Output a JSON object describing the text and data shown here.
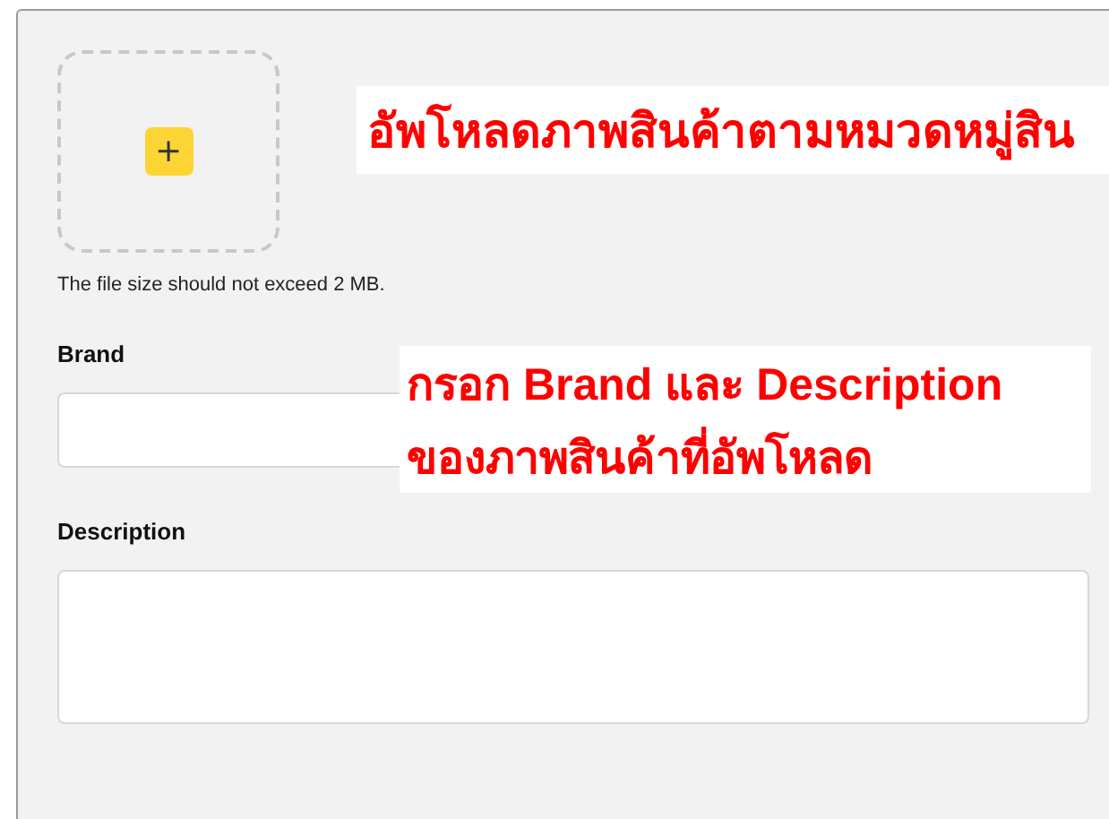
{
  "upload": {
    "button": "+",
    "hint": "The file size should not exceed 2 MB."
  },
  "fields": [
    {
      "label": "Brand",
      "kind": "input"
    },
    {
      "label": "Description",
      "kind": "textarea"
    }
  ],
  "annotations": [
    {
      "lines": [
        "อัพโหลดภาพสินค้าตามหมวดหมู่สิน"
      ]
    },
    {
      "lines": [
        "กรอก Brand และ Description",
        "ของภาพสินค้าที่อัพโหลด"
      ]
    }
  ]
}
